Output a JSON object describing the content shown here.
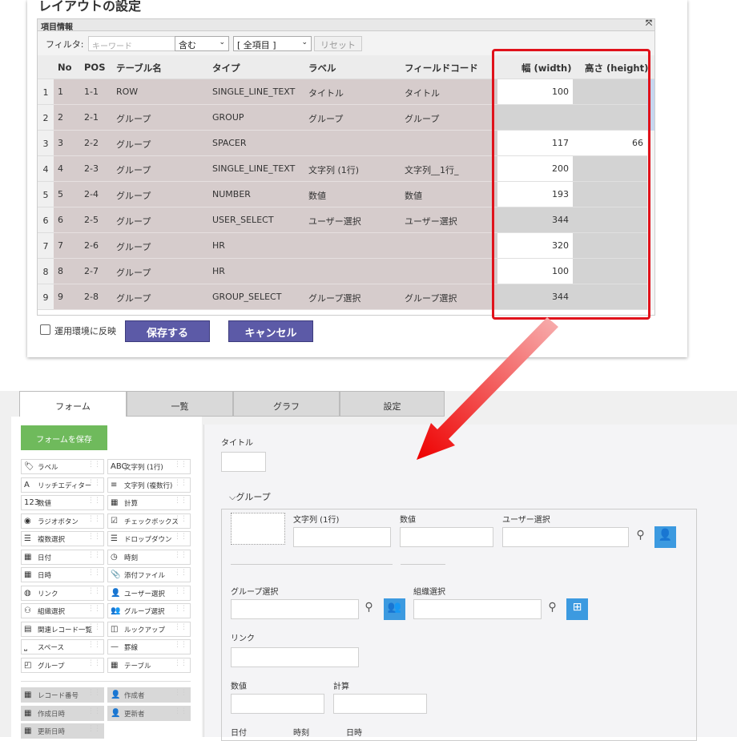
{
  "layout_title": "レイアウトの設定",
  "info_header": "項目情報",
  "filter": {
    "label": "フィルタ:",
    "keyword_placeholder": "キーワード",
    "op": "含む",
    "field": "[ 全項目 ]",
    "reset": "リセット"
  },
  "columns": [
    "No",
    "POS",
    "テーブル名",
    "タイプ",
    "ラベル",
    "フィールドコード",
    "幅 (width)",
    "高さ (height)"
  ],
  "rows": [
    {
      "n": "1",
      "no": "1",
      "pos": "1-1",
      "table": "ROW",
      "type": "SINGLE_LINE_TEXT",
      "label": "タイトル",
      "code": "タイトル",
      "width": "100",
      "height": ""
    },
    {
      "n": "2",
      "no": "2",
      "pos": "2-1",
      "table": "グループ",
      "type": "GROUP",
      "label": "グループ",
      "code": "グループ",
      "width": "",
      "height": ""
    },
    {
      "n": "3",
      "no": "3",
      "pos": "2-2",
      "table": "グループ",
      "type": "SPACER",
      "label": "",
      "code": "",
      "width": "117",
      "height": "66"
    },
    {
      "n": "4",
      "no": "4",
      "pos": "2-3",
      "table": "グループ",
      "type": "SINGLE_LINE_TEXT",
      "label": "文字列 (1行)",
      "code": "文字列__1行_",
      "width": "200",
      "height": ""
    },
    {
      "n": "5",
      "no": "5",
      "pos": "2-4",
      "table": "グループ",
      "type": "NUMBER",
      "label": "数値",
      "code": "数値",
      "width": "193",
      "height": ""
    },
    {
      "n": "6",
      "no": "6",
      "pos": "2-5",
      "table": "グループ",
      "type": "USER_SELECT",
      "label": "ユーザー選択",
      "code": "ユーザー選択",
      "width": "344",
      "height": ""
    },
    {
      "n": "7",
      "no": "7",
      "pos": "2-6",
      "table": "グループ",
      "type": "HR",
      "label": "",
      "code": "",
      "width": "320",
      "height": ""
    },
    {
      "n": "8",
      "no": "8",
      "pos": "2-7",
      "table": "グループ",
      "type": "HR",
      "label": "",
      "code": "",
      "width": "100",
      "height": ""
    },
    {
      "n": "9",
      "no": "9",
      "pos": "2-8",
      "table": "グループ",
      "type": "GROUP_SELECT",
      "label": "グループ選択",
      "code": "グループ選択",
      "width": "344",
      "height": ""
    }
  ],
  "apply_label": "運用環境に反映",
  "save_label": "保存する",
  "cancel_label": "キャンセル",
  "tabs": [
    "フォーム",
    "一覧",
    "グラフ",
    "設定"
  ],
  "save_form": "フォームを保存",
  "palette": [
    [
      "ラベル",
      "文字列 (1行)"
    ],
    [
      "リッチエディター",
      "文字列 (複数行)"
    ],
    [
      "数値",
      "計算"
    ],
    [
      "ラジオボタン",
      "チェックボックス"
    ],
    [
      "複数選択",
      "ドロップダウン"
    ],
    [
      "日付",
      "時刻"
    ],
    [
      "日時",
      "添付ファイル"
    ],
    [
      "リンク",
      "ユーザー選択"
    ],
    [
      "組織選択",
      "グループ選択"
    ],
    [
      "関連レコード一覧",
      "ルックアップ"
    ],
    [
      "スペース",
      "罫線"
    ],
    [
      "グループ",
      "テーブル"
    ]
  ],
  "palette_sys": [
    [
      "レコード番号",
      "作成者"
    ],
    [
      "作成日時",
      "更新者"
    ],
    [
      "更新日時",
      ""
    ]
  ],
  "form": {
    "title": "タイトル",
    "group": "グループ",
    "text1": "文字列 (1行)",
    "number": "数値",
    "user": "ユーザー選択",
    "group_sel": "グループ選択",
    "org_sel": "組織選択",
    "link": "リンク",
    "number2": "数値",
    "calc": "計算",
    "date": "日付",
    "time": "時刻",
    "datetime": "日時"
  }
}
